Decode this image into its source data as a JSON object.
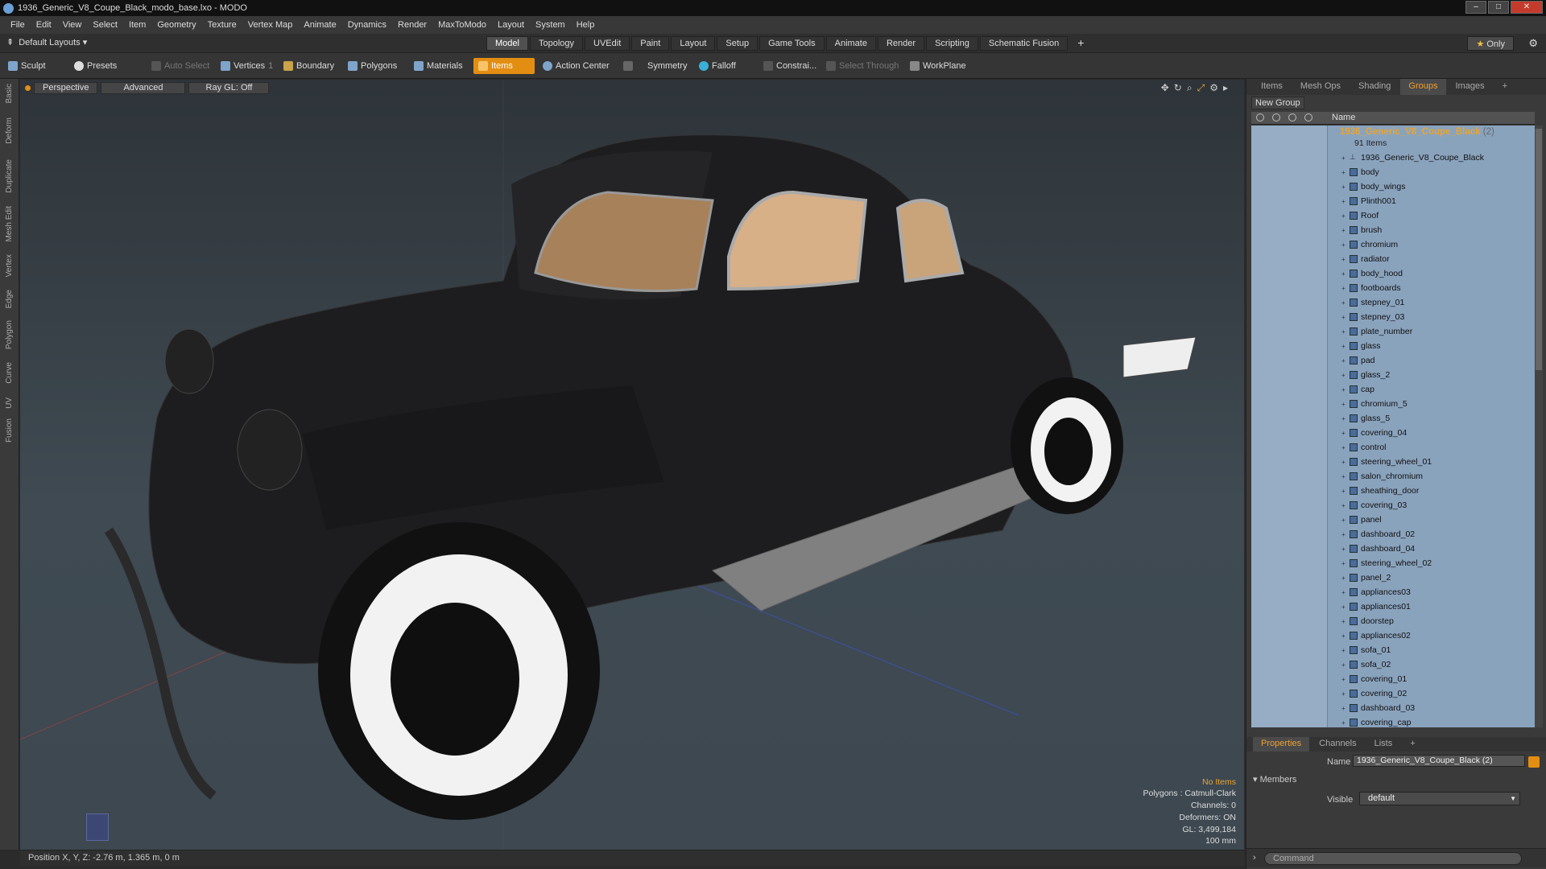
{
  "window": {
    "title": "1936_Generic_V8_Coupe_Black_modo_base.lxo - MODO",
    "buttons": [
      "–",
      "□",
      "✕"
    ]
  },
  "menu": [
    "File",
    "Edit",
    "View",
    "Select",
    "Item",
    "Geometry",
    "Texture",
    "Vertex Map",
    "Animate",
    "Dynamics",
    "Render",
    "MaxToModo",
    "Layout",
    "System",
    "Help"
  ],
  "layouts": {
    "label": "Default Layouts ▾"
  },
  "mode_tabs": [
    {
      "label": "Model",
      "active": true
    },
    {
      "label": "Topology"
    },
    {
      "label": "UVEdit"
    },
    {
      "label": "Paint"
    },
    {
      "label": "Layout"
    },
    {
      "label": "Setup"
    },
    {
      "label": "Game Tools"
    },
    {
      "label": "Animate"
    },
    {
      "label": "Render"
    },
    {
      "label": "Scripting"
    },
    {
      "label": "Schematic Fusion"
    },
    {
      "label": "+"
    }
  ],
  "only_button": {
    "star": "★",
    "label": "Only"
  },
  "toolbar": {
    "sculpt": "Sculpt",
    "presets": "Presets",
    "auto_select": "Auto Select",
    "vertices": "Vertices",
    "vertices_count": "1",
    "boundary": "Boundary",
    "polygons": "Polygons",
    "materials": "Materials",
    "items": "Items",
    "action_center": "Action Center",
    "symmetry": "Symmetry",
    "falloff": "Falloff",
    "constrain": "Constrai...",
    "select_through": "Select Through",
    "workplane": "WorkPlane"
  },
  "left_strip": [
    "Basic",
    "Deform",
    "Duplicate",
    "Mesh Edit",
    "Vertex",
    "Edge",
    "Polygon",
    "Curve",
    "UV",
    "Fusion"
  ],
  "viewport": {
    "view": "Perspective",
    "advanced": "Advanced",
    "raygl": "Ray GL: Off",
    "info": {
      "items": "No Items",
      "polygons": "Polygons : Catmull-Clark",
      "channels": "Channels: 0",
      "deformers": "Deformers: ON",
      "gl": "GL: 3,499,184",
      "scale": "100 mm"
    }
  },
  "status": {
    "position": "Position X, Y, Z:  -2.76 m, 1.365 m, 0 m"
  },
  "right_tabs": [
    {
      "label": "Items"
    },
    {
      "label": "Mesh Ops"
    },
    {
      "label": "Shading"
    },
    {
      "label": "Groups",
      "active": true
    },
    {
      "label": "Images"
    },
    {
      "label": "+"
    }
  ],
  "groups": {
    "new_group": "New Group",
    "col_name": "Name",
    "root": {
      "name": "1936_Generic_V8_Coupe_Black",
      "count": "(2)",
      "sub": "91 Items"
    },
    "items": [
      "1936_Generic_V8_Coupe_Black",
      "body",
      "body_wings",
      "Plinth001",
      "Roof",
      "brush",
      "chromium",
      "radiator",
      "body_hood",
      "footboards",
      "stepney_01",
      "stepney_03",
      "plate_number",
      "glass",
      "pad",
      "glass_2",
      "cap",
      "chromium_5",
      "glass_5",
      "covering_04",
      "control",
      "steering_wheel_01",
      "salon_chromium",
      "sheathing_door",
      "covering_03",
      "panel",
      "dashboard_02",
      "dashboard_04",
      "steering_wheel_02",
      "panel_2",
      "appliances03",
      "appliances01",
      "doorstep",
      "appliances02",
      "sofa_01",
      "sofa_02",
      "covering_01",
      "covering_02",
      "dashboard_03",
      "covering_cap"
    ]
  },
  "prop_tabs": [
    {
      "label": "Properties",
      "active": true
    },
    {
      "label": "Channels"
    },
    {
      "label": "Lists"
    },
    {
      "label": "+"
    }
  ],
  "properties": {
    "name_label": "Name",
    "name_value": "1936_Generic_V8_Coupe_Black (2)",
    "members": "Members",
    "visible_label": "Visible",
    "visible_value": "default"
  },
  "command": {
    "placeholder": "Command"
  }
}
